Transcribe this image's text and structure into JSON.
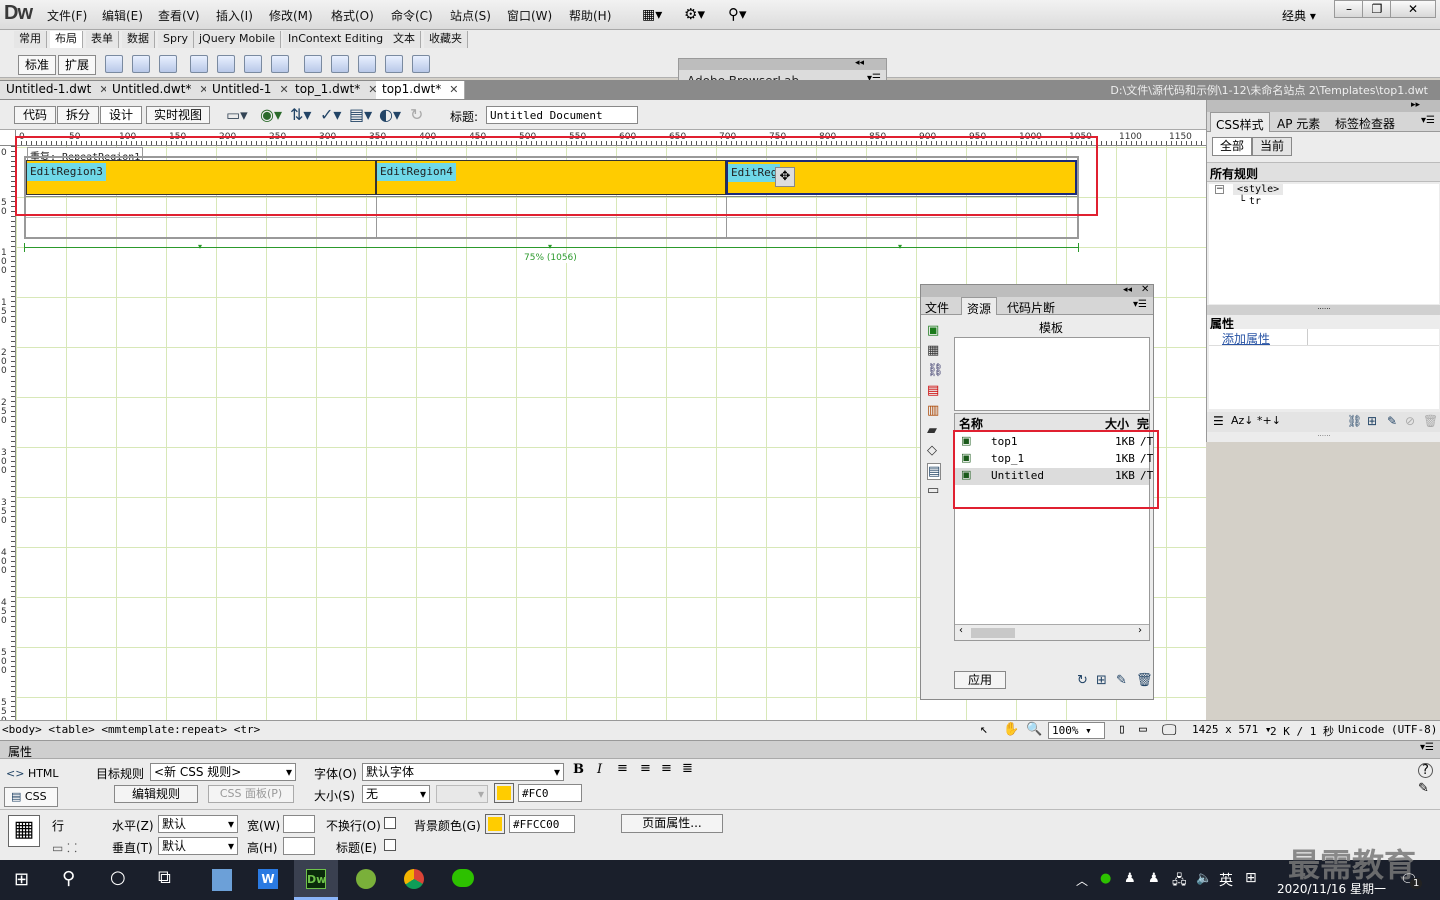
{
  "menubar": {
    "logo": "Dw",
    "items": [
      "文件(F)",
      "编辑(E)",
      "查看(V)",
      "插入(I)",
      "修改(M)",
      "格式(O)",
      "命令(C)",
      "站点(S)",
      "窗口(W)",
      "帮助(H)"
    ],
    "workspace": "经典"
  },
  "insert": {
    "tabs": [
      "常用",
      "布局",
      "表单",
      "数据",
      "Spry",
      "jQuery Mobile",
      "InContext Editing",
      "文本",
      "收藏夹"
    ],
    "modes": [
      "标准",
      "扩展"
    ]
  },
  "browserlab": {
    "title": "Adobe BrowserLab"
  },
  "doctabs": [
    "Untitled-1.dwt",
    "Untitled.dwt*",
    "Untitled-1",
    "top_1.dwt*",
    "top1.dwt*"
  ],
  "filepath": "D:\\文件\\源代码和示例\\1-12\\未命名站点 2\\Templates\\top1.dwt",
  "doctoolbar": {
    "views": [
      "代码",
      "拆分",
      "设计",
      "实时视图"
    ],
    "title_label": "标题:",
    "title_value": "Untitled Document"
  },
  "ruler": {
    "h": [
      "0",
      "50",
      "100",
      "150",
      "200",
      "250",
      "300",
      "350",
      "400",
      "450",
      "500",
      "550",
      "600",
      "650",
      "700",
      "750",
      "800",
      "850",
      "900",
      "950",
      "1000",
      "1050",
      "1100",
      "1150"
    ],
    "v": [
      "0",
      "50",
      "100",
      "150",
      "200",
      "250",
      "300",
      "350",
      "400",
      "450",
      "500",
      "550"
    ]
  },
  "design": {
    "repeat_label": "重复: RepeatRegion1",
    "regions": [
      "EditRegion3",
      "EditRegion4",
      "EditReg"
    ],
    "width_label": "75% (1056)"
  },
  "resources": {
    "tabs": [
      "文件",
      "资源",
      "代码片断"
    ],
    "heading": "模板",
    "columns": [
      "名称",
      "大小",
      "完"
    ],
    "rows": [
      {
        "name": "top1",
        "size": "1KB",
        "path": "/T"
      },
      {
        "name": "top_1",
        "size": "1KB",
        "path": "/T"
      },
      {
        "name": "Untitled",
        "size": "1KB",
        "path": "/T"
      }
    ],
    "apply": "应用"
  },
  "css": {
    "tabs": [
      "CSS样式",
      "AP 元素",
      "标签检查器"
    ],
    "modes": [
      "全部",
      "当前"
    ],
    "all_rules": "所有规则",
    "tree": [
      "<style>",
      "tr"
    ],
    "props_title": "属性",
    "add_prop": "添加属性"
  },
  "tagbar": {
    "path": "<body> <table> <mmtemplate:repeat> <tr>",
    "zoom": "100%",
    "size": "1425 x 571",
    "weight": "2 K / 1 秒",
    "encoding": "Unicode (UTF-8)"
  },
  "props": {
    "title": "属性",
    "html": "HTML",
    "css": "CSS",
    "target_rule_label": "目标规则",
    "target_rule": "<新 CSS 规则>",
    "edit_rule": "编辑规则",
    "css_panel": "CSS 面板(P)",
    "font_label": "字体(O)",
    "font": "默认字体",
    "size_label": "大小(S)",
    "size": "无",
    "color": "#FC0",
    "row_label": "行",
    "halign_label": "水平(Z)",
    "halign": "默认",
    "valign_label": "垂直(T)",
    "valign": "默认",
    "width_label": "宽(W)",
    "height_label": "高(H)",
    "nowrap_label": "不换行(O)",
    "header_label": "标题(E)",
    "bg_label": "背景颜色(G)",
    "bg": "#FFCC00",
    "page_props": "页面属性...",
    "accent": "#ffcc00"
  },
  "taskbar": {
    "ime": "英",
    "datetime": "2020/11/16 星期一",
    "watermark": "最需教育",
    "badge": "1"
  }
}
